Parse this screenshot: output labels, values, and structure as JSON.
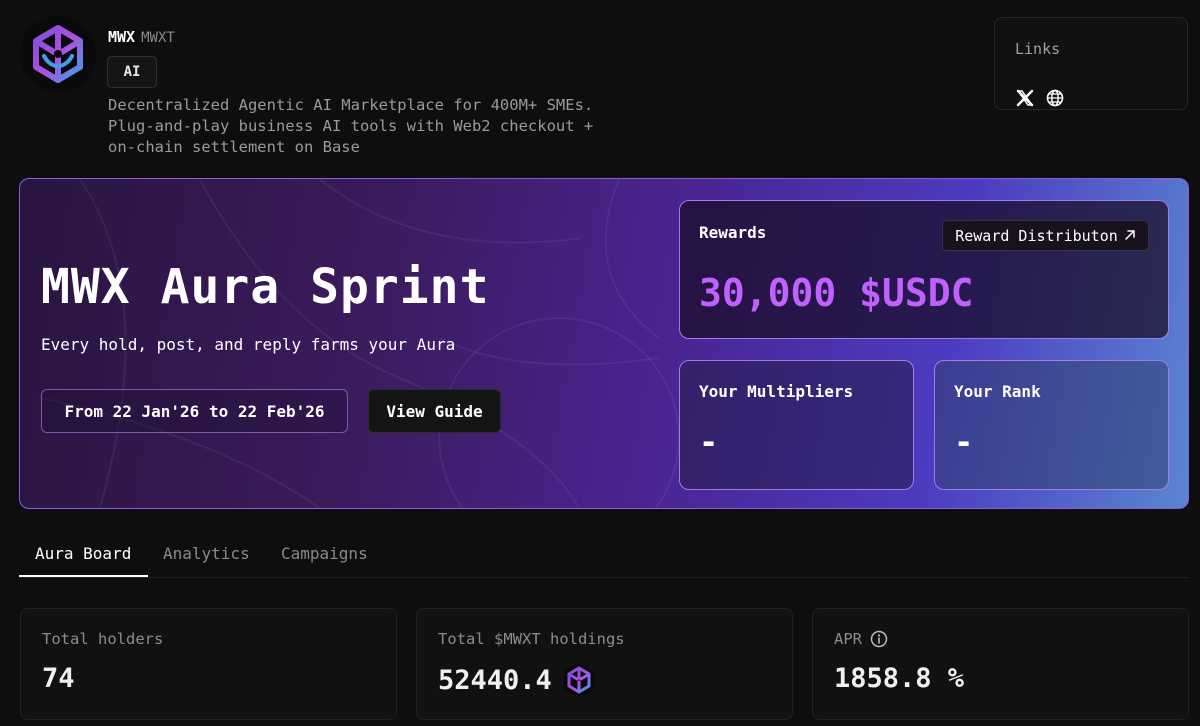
{
  "project": {
    "name": "MWX",
    "ticker": "MWXT",
    "tag": "AI",
    "description": "Decentralized Agentic AI Marketplace for 400M+ SMEs. Plug-and-play business AI tools with Web2 checkout + on-chain settlement on Base",
    "logo_icon": "mwx-logo-icon"
  },
  "links": {
    "title": "Links",
    "items": [
      {
        "icon": "x-icon"
      },
      {
        "icon": "globe-icon"
      }
    ]
  },
  "hero": {
    "title": "MWX Aura Sprint",
    "subtitle": "Every hold, post, and reply farms your Aura",
    "date_range": "From 22 Jan'26 to 22 Feb'26",
    "guide_button": "View Guide",
    "rewards": {
      "label": "Rewards",
      "distribution_button": "Reward Distributon",
      "value": "30,000 $USDC"
    },
    "multipliers": {
      "label": "Your Multipliers",
      "value": "-"
    },
    "rank": {
      "label": "Your Rank",
      "value": "-"
    }
  },
  "tabs": [
    {
      "label": "Aura Board",
      "active": true
    },
    {
      "label": "Analytics",
      "active": false
    },
    {
      "label": "Campaigns",
      "active": false
    }
  ],
  "stats": [
    {
      "label": "Total holders",
      "value": "74"
    },
    {
      "label": "Total $MWXT holdings",
      "value": "52440.4",
      "icon": "mwx-token-icon"
    },
    {
      "label": "APR",
      "value": "1858.8 %",
      "icon": "info-icon"
    }
  ],
  "colors": {
    "background": "#0e0e0e",
    "accent_purple": "#c060ff",
    "hero_border": "#8d5dd9"
  }
}
